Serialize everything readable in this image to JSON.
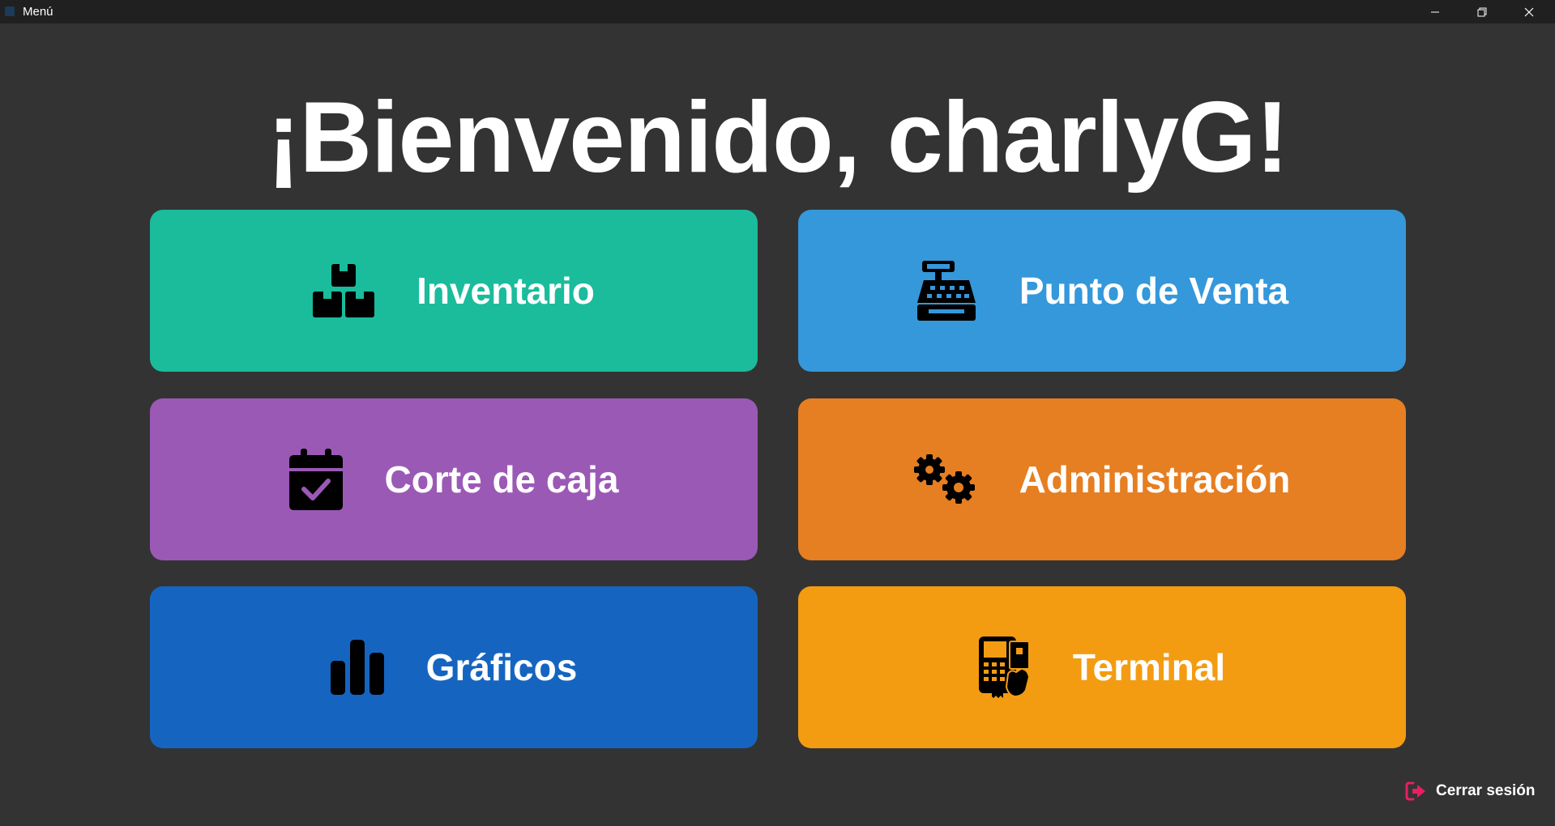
{
  "window": {
    "title": "Menú",
    "controls": [
      "minimize-icon",
      "restore-icon",
      "close-icon"
    ]
  },
  "welcome": {
    "text": "¡Bienvenido, charlyG!"
  },
  "tiles": [
    {
      "label": "Inventario",
      "icon": "boxes-icon",
      "color": "#1ABC9C"
    },
    {
      "label": "Punto de Venta",
      "icon": "cash-register-icon",
      "color": "#3498DB"
    },
    {
      "label": "Corte de caja",
      "icon": "calendar-check-icon",
      "color": "#9B59B6"
    },
    {
      "label": "Administración",
      "icon": "gears-icon",
      "color": "#E67E22"
    },
    {
      "label": "Gráficos",
      "icon": "bar-chart-icon",
      "color": "#1565C0"
    },
    {
      "label": "Terminal",
      "icon": "payment-terminal-icon",
      "color": "#F39C12"
    }
  ],
  "logout": {
    "label": "Cerrar sesión",
    "icon": "sign-out-icon",
    "icon_color": "#E91E63"
  },
  "theme": {
    "background": "#333333",
    "titlebar": "#202020"
  }
}
